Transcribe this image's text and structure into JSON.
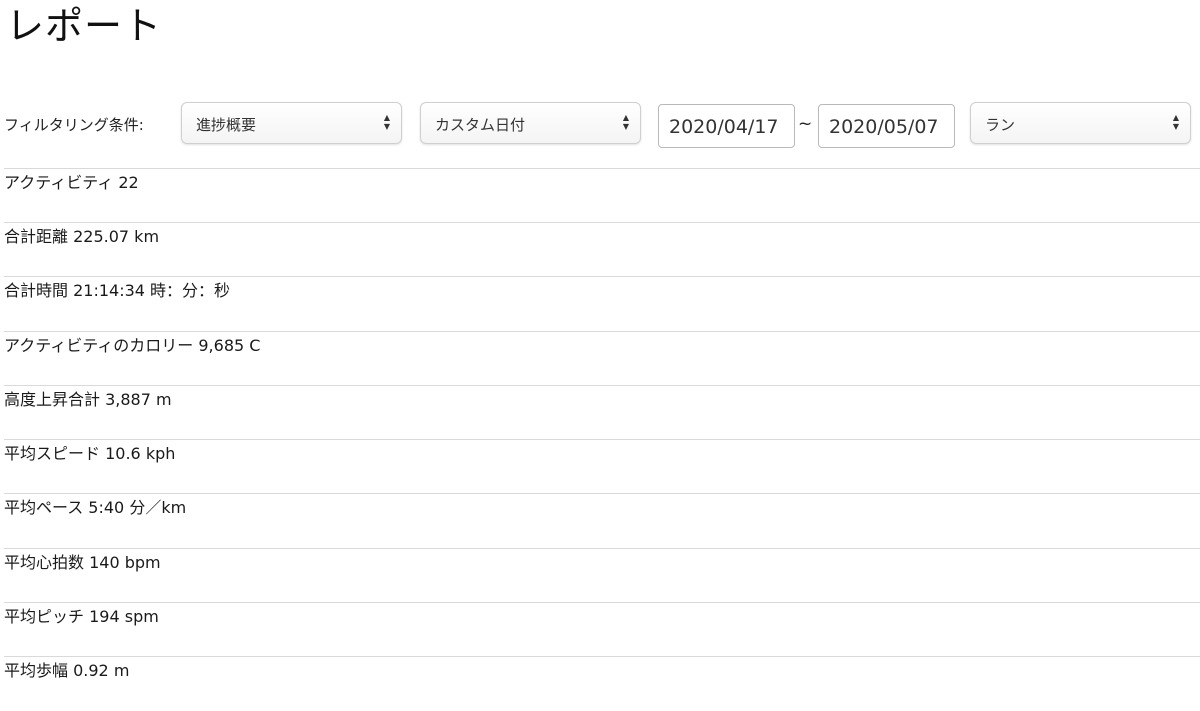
{
  "page": {
    "title": "レポート"
  },
  "filters": {
    "label": "フィルタリング条件:",
    "report_type": "進捗概要",
    "date_range_type": "カスタム日付",
    "start_date": "2020/04/17",
    "separator": "~",
    "end_date": "2020/05/07",
    "activity_type": "ラン"
  },
  "stats": [
    {
      "label": "アクティビティ",
      "value": "22"
    },
    {
      "label": "合計距離",
      "value": "225.07 km"
    },
    {
      "label": "合計時間",
      "value": "21:14:34 時：分：秒"
    },
    {
      "label": "アクティビティのカロリー",
      "value": "9,685 C"
    },
    {
      "label": "高度上昇合計",
      "value": "3,887 m"
    },
    {
      "label": "平均スピード",
      "value": "10.6 kph"
    },
    {
      "label": "平均ペース",
      "value": "5:40 分／km"
    },
    {
      "label": "平均心拍数",
      "value": "140 bpm"
    },
    {
      "label": "平均ピッチ",
      "value": "194 spm"
    },
    {
      "label": "平均歩幅",
      "value": "0.92 m"
    }
  ],
  "colors": {
    "row_border": "#d9d9d9",
    "text": "#1a1a1a"
  },
  "icons": {
    "select_arrow": "up-down-chevron-icon"
  }
}
